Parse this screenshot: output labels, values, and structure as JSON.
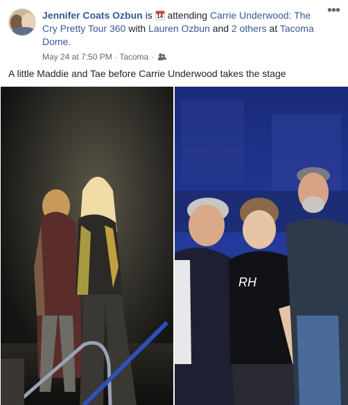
{
  "post": {
    "author": "Jennifer Coats Ozbun",
    "verb": "is",
    "calendar_day": "14",
    "activity": "attending",
    "event": "Carrie Underwood: The Cry Pretty Tour 360",
    "with_text": "with",
    "with_person": "Lauren Ozbun",
    "and_text": "and",
    "others": "2 others",
    "at_text": "at",
    "place": "Tacoma Dome",
    "timestamp": "May 24 at 7:50 PM",
    "separator": "·",
    "location": "Tacoma",
    "caption": "A little Maddie and Tae before Carrie Underwood takes the stage",
    "more_label": "•••"
  },
  "icons": {
    "avatar": "profile-avatar",
    "calendar": "calendar-icon",
    "privacy": "friends-icon",
    "more": "more-options-icon"
  },
  "colors": {
    "link": "#385898",
    "text": "#1d2129",
    "meta": "#616770",
    "calendar_red": "#e0403a"
  }
}
